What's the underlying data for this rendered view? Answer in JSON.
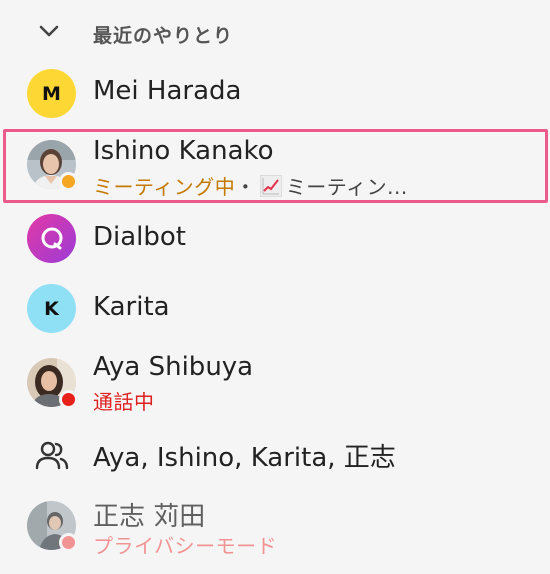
{
  "section": {
    "title": "最近のやりとり"
  },
  "contacts": [
    {
      "name": "Mei Harada",
      "initial": "M",
      "avatar_color": "#fdd835"
    },
    {
      "name": "Ishino Kanako",
      "status_text": "ミーティング中",
      "separator": "・",
      "activity_text": "ミーティン...",
      "status_color": "#f5a623",
      "status_text_color": "#c47a00"
    },
    {
      "name": "Dialbot",
      "avatar_color": "#c23fc2"
    },
    {
      "name": "Karita",
      "initial": "K",
      "avatar_color": "#8fe0f5"
    },
    {
      "name": "Aya Shibuya",
      "status_text": "通話中",
      "status_color": "#e8201a",
      "status_text_color": "#e02020"
    },
    {
      "name": "Aya, Ishino, Karita, 正志"
    },
    {
      "name": "正志 苅田",
      "status_text": "プライバシーモード",
      "status_color": "#f06a6a",
      "status_text_color": "#f06a6a"
    }
  ],
  "icons": {
    "section_toggle": "chevron-down-icon",
    "group": "group-icon",
    "dialbot": "chat-bubble-icon",
    "activity": "chart-increasing-icon"
  }
}
